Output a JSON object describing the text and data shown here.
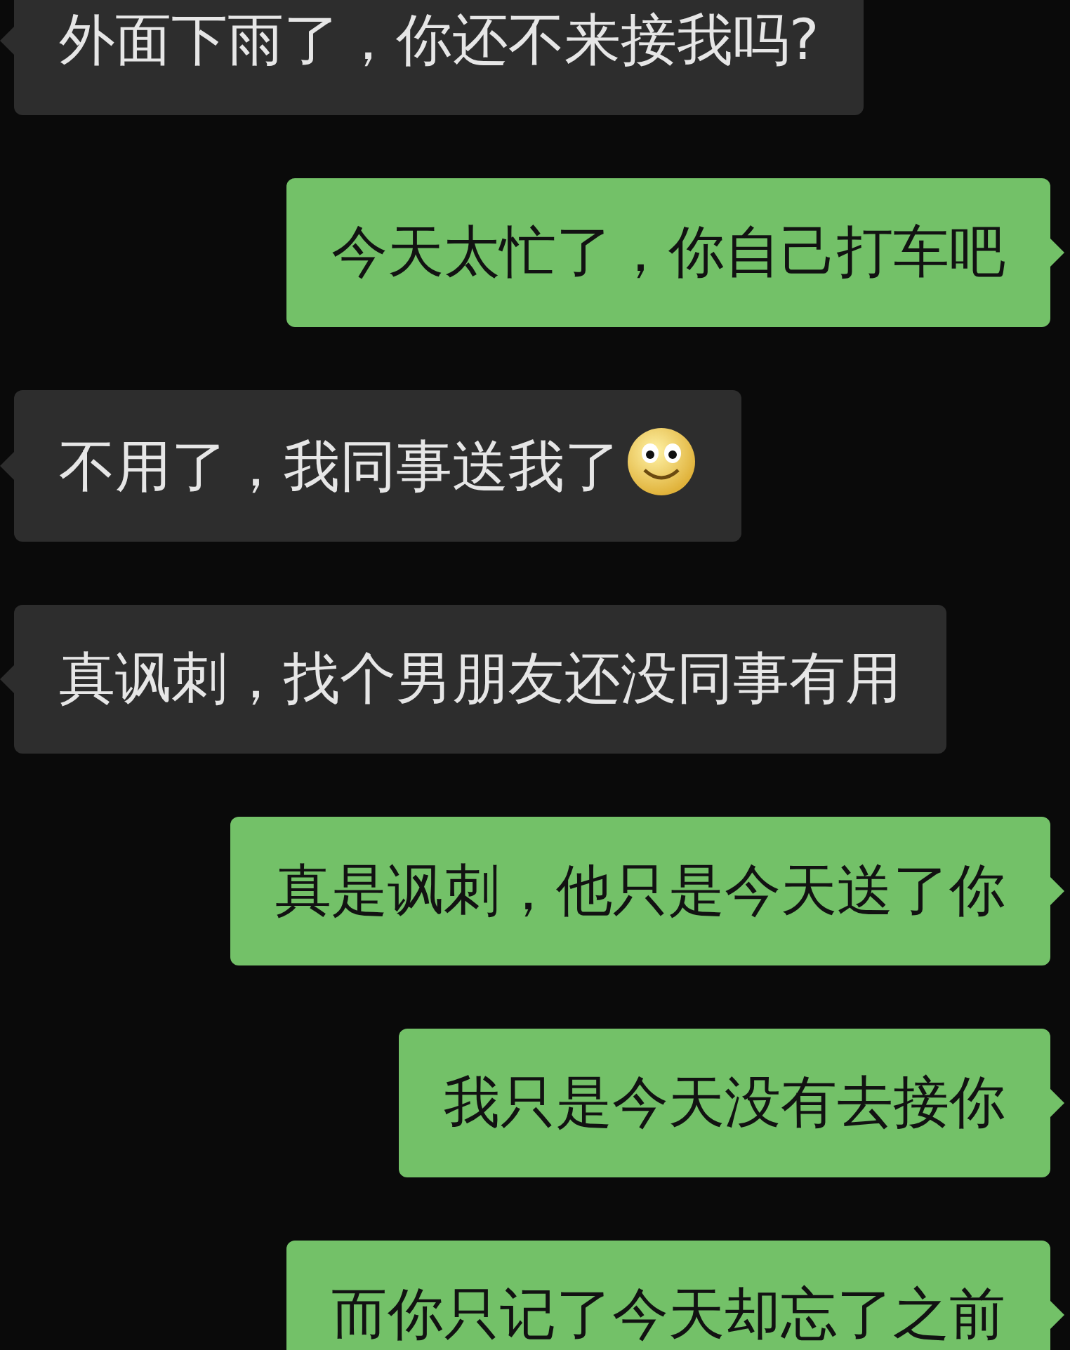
{
  "messages": [
    {
      "kind": "received",
      "text": "外面下雨了，你还不来接我吗?"
    },
    {
      "kind": "sent",
      "text": "今天太忙了，你自己打车吧"
    },
    {
      "kind": "received",
      "text": "不用了，我同事送我了",
      "smiley": true
    },
    {
      "kind": "received",
      "text": "真讽刺，找个男朋友还没同事有用"
    },
    {
      "kind": "sent",
      "text": "真是讽刺，他只是今天送了你"
    },
    {
      "kind": "sent",
      "text": "我只是今天没有去接你"
    },
    {
      "kind": "sent",
      "text": "而你只记了今天却忘了之前"
    }
  ]
}
